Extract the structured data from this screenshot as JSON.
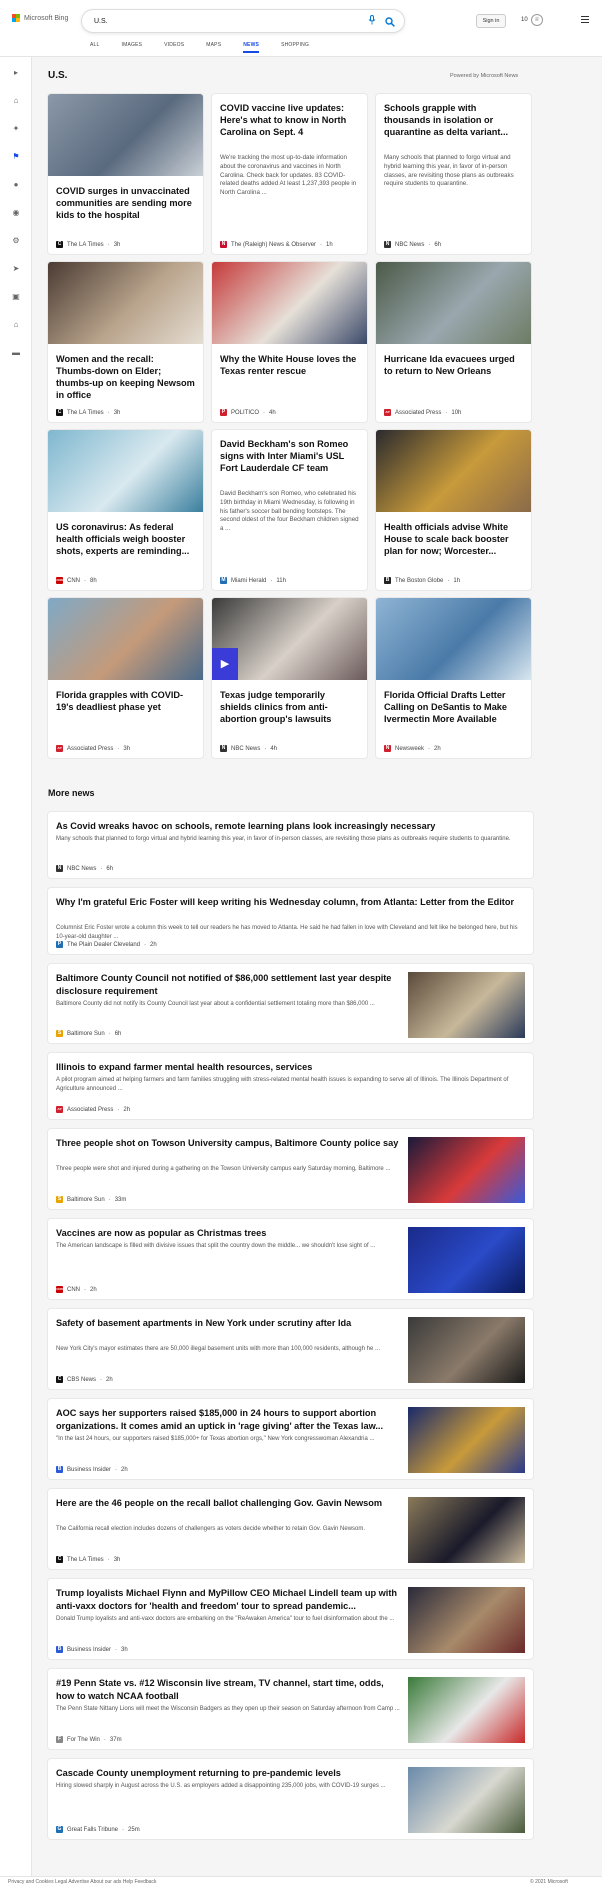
{
  "header": {
    "logo_text": "Microsoft Bing",
    "search_value": "U.S.",
    "signin_label": "Sign in",
    "reward_count": "10",
    "tabs": [
      "ALL",
      "IMAGES",
      "VIDEOS",
      "MAPS",
      "NEWS",
      "SHOPPING"
    ],
    "active_tab": "NEWS"
  },
  "rail": {
    "icons": [
      "expand-icon",
      "home-icon",
      "discover-icon",
      "flag-icon",
      "location-icon",
      "globe-icon",
      "tech-icon",
      "science-icon",
      "entertainment-icon",
      "politics-icon",
      "money-icon"
    ]
  },
  "page": {
    "title": "U.S.",
    "powered_by": "Powered by Microsoft News"
  },
  "top_stories": [
    {
      "title": "COVID surges in unvaccinated communities are sending more kids to the hospital",
      "snippet": "",
      "source": "The LA Times",
      "time": "3h",
      "src_icon": "C",
      "src_color": "#111111",
      "has_image": true,
      "img_colors": [
        "#8b98a8",
        "#5a6a7e",
        "#c9cfd6"
      ]
    },
    {
      "title": "COVID vaccine live updates: Here's what to know in North Carolina on Sept. 4",
      "snippet": "We're tracking the most up-to-date information about the coronavirus and vaccines in North Carolina. Check back for updates. 83 COVID-related deaths added At least 1,237,393 people in North Carolina ...",
      "source": "The (Raleigh) News & Observer",
      "time": "1h",
      "src_icon": "N",
      "src_color": "#c8102e",
      "has_image": false
    },
    {
      "title": "Schools grapple with thousands in isolation or quarantine as delta variant...",
      "snippet": "Many schools that planned to forgo virtual and hybrid learning this year, in favor of in-person classes, are revisiting those plans as outbreaks require students to quarantine.",
      "source": "NBC News",
      "time": "6h",
      "src_icon": "N",
      "src_color": "#333333",
      "has_image": false
    },
    {
      "title": "Women and the recall: Thumbs-down on Elder; thumbs-up on keeping Newsom in office",
      "snippet": "",
      "source": "The LA Times",
      "time": "3h",
      "src_icon": "C",
      "src_color": "#111111",
      "has_image": true,
      "img_colors": [
        "#4a3b33",
        "#b9a48c",
        "#e5ddd2"
      ]
    },
    {
      "title": "Why the White House loves the Texas renter rescue",
      "snippet": "",
      "source": "POLITICO",
      "time": "4h",
      "src_icon": "P",
      "src_color": "#d0202e",
      "has_image": true,
      "img_colors": [
        "#c53a3a",
        "#e6e0d8",
        "#3c4a6a"
      ]
    },
    {
      "title": "Hurricane Ida evacuees urged to return to New Orleans",
      "snippet": "",
      "source": "Associated Press",
      "time": "10h",
      "src_icon": "AP",
      "src_color": "#d0202e",
      "has_image": true,
      "img_colors": [
        "#4b5a48",
        "#9aa7ae",
        "#6d7c64"
      ]
    },
    {
      "title": "US coronavirus: As federal health officials weigh booster shots, experts are reminding...",
      "snippet": "",
      "source": "CNN",
      "time": "8h",
      "src_icon": "CNN",
      "src_color": "#cc0000",
      "has_image": true,
      "img_colors": [
        "#7fb7cf",
        "#d9e9ef",
        "#3b7f9e"
      ]
    },
    {
      "title": "David Beckham's son Romeo signs with Inter Miami's USL Fort Lauderdale CF team",
      "snippet": "David Beckham's son Romeo, who celebrated his 19th birthday in Miami Wednesday, is following in his father's soccer ball bending footsteps. The second oldest of the four Beckham children signed a ...",
      "source": "Miami Herald",
      "time": "11h",
      "src_icon": "M",
      "src_color": "#1f6fb2",
      "has_image": false
    },
    {
      "title": "Health officials advise White House to scale back booster plan for now; Worcester...",
      "snippet": "",
      "source": "The Boston Globe",
      "time": "1h",
      "src_icon": "B",
      "src_color": "#222222",
      "has_image": true,
      "img_colors": [
        "#2a2a2e",
        "#c89a3a",
        "#8a6a4a"
      ]
    },
    {
      "title": "Florida grapples with COVID-19's deadliest phase yet",
      "snippet": "",
      "source": "Associated Press",
      "time": "3h",
      "src_icon": "AP",
      "src_color": "#d0202e",
      "has_image": true,
      "img_colors": [
        "#7fa9c6",
        "#c49a7a",
        "#4a6a8a"
      ]
    },
    {
      "title": "Texas judge temporarily shields clinics from anti-abortion group's lawsuits",
      "snippet": "",
      "source": "NBC News",
      "time": "4h",
      "src_icon": "N",
      "src_color": "#333333",
      "has_image": true,
      "video": true,
      "img_colors": [
        "#3a3a3a",
        "#d8d0c8",
        "#6a5a5a"
      ]
    },
    {
      "title": "Florida Official Drafts Letter Calling on DeSantis to Make Ivermectin More Available",
      "snippet": "",
      "source": "Newsweek",
      "time": "2h",
      "src_icon": "N",
      "src_color": "#d0202e",
      "has_image": true,
      "img_colors": [
        "#8fb4d4",
        "#4a7aa8",
        "#d8e6f0"
      ]
    }
  ],
  "more_news": {
    "heading": "More news",
    "items": [
      {
        "title": "As Covid wreaks havoc on schools, remote learning plans look increasingly necessary",
        "snippet": "Many schools that planned to forgo virtual and hybrid learning this year, in favor of in-person classes, are revisiting those plans as outbreaks require students to quarantine.",
        "source": "NBC News",
        "time": "6h",
        "src_icon": "N",
        "src_color": "#333333",
        "has_image": false
      },
      {
        "title": "Why I'm grateful Eric Foster will keep writing his Wednesday column, from Atlanta: Letter from the Editor",
        "snippet": "Columnist Eric Foster wrote a column this week to tell our readers he has moved to Atlanta. He said he had fallen in love with Cleveland and felt like he belonged here, but his 10-year-old daughter ...",
        "source": "The Plain Dealer Cleveland",
        "time": "2h",
        "src_icon": "P",
        "src_color": "#1f6fb2",
        "has_image": false
      },
      {
        "title": "Baltimore County Council not notified of $86,000 settlement last year despite disclosure requirement",
        "snippet": "Baltimore County did not notify its County Council last year about a confidential settlement totaling more than $86,000 ...",
        "source": "Baltimore Sun",
        "time": "6h",
        "src_icon": "S",
        "src_color": "#e8a400",
        "has_image": true,
        "img_colors": [
          "#5a4a3a",
          "#c8b89a",
          "#2a3a5a"
        ]
      },
      {
        "title": "Illinois to expand farmer mental health resources, services",
        "snippet": "A pilot program aimed at helping farmers and farm families struggling with stress-related mental health issues is expanding to serve all of Illinois. The Illinois Department of Agriculture announced ...",
        "source": "Associated Press",
        "time": "2h",
        "src_icon": "AP",
        "src_color": "#d0202e",
        "has_image": false
      },
      {
        "title": "Three people shot on Towson University campus, Baltimore County police say",
        "snippet": "Three people were shot and injured during a gathering on the Towson University campus early Saturday morning, Baltimore ...",
        "source": "Baltimore Sun",
        "time": "33m",
        "src_icon": "S",
        "src_color": "#e8a400",
        "has_image": true,
        "img_colors": [
          "#1a1a3a",
          "#d83a3a",
          "#3a5ad8"
        ]
      },
      {
        "title": "Vaccines are now as popular as Christmas trees",
        "snippet": "The American landscape is filled with divisive issues that split the country down the middle... we shouldn't lose sight of ...",
        "source": "CNN",
        "time": "2h",
        "src_icon": "CNN",
        "src_color": "#cc0000",
        "has_image": true,
        "img_colors": [
          "#1a2a8a",
          "#2a4ac8",
          "#0a1a5a"
        ]
      },
      {
        "title": "Safety of basement apartments in New York under scrutiny after Ida",
        "snippet": "New York City's mayor estimates there are 50,000 illegal basement units with more than 100,000 residents, although he ...",
        "source": "CBS News",
        "time": "2h",
        "src_icon": "C",
        "src_color": "#111111",
        "has_image": true,
        "img_colors": [
          "#3a3a3a",
          "#8a7a6a",
          "#1a1a1a"
        ]
      },
      {
        "title": "AOC says her supporters raised $185,000 in 24 hours to support abortion organizations. It comes amid an uptick in 'rage giving' after the Texas law...",
        "snippet": "\"In the last 24 hours, our supporters raised $185,000+ for Texas abortion orgs,\" New York congresswoman Alexandria ...",
        "source": "Business Insider",
        "time": "2h",
        "src_icon": "B",
        "src_color": "#2a5ad8",
        "has_image": true,
        "img_colors": [
          "#1a2a6a",
          "#c89a3a",
          "#2a3a8a"
        ]
      },
      {
        "title": "Here are the 46 people on the recall ballot challenging Gov. Gavin Newsom",
        "snippet": "The California recall election includes dozens of challengers as voters decide whether to retain Gov. Gavin Newsom.",
        "source": "The LA Times",
        "time": "3h",
        "src_icon": "C",
        "src_color": "#111111",
        "has_image": true,
        "img_colors": [
          "#8a7a5a",
          "#1a1a2a",
          "#c8b89a"
        ]
      },
      {
        "title": "Trump loyalists Michael Flynn and MyPillow CEO Michael Lindell team up with anti-vaxx doctors for 'health and freedom' tour to spread pandemic...",
        "snippet": "Donald Trump loyalists and anti-vaxx doctors are embarking on the \"ReAwaken America\" tour to fuel disinformation about the ...",
        "source": "Business Insider",
        "time": "3h",
        "src_icon": "B",
        "src_color": "#2a5ad8",
        "has_image": true,
        "img_colors": [
          "#2a2a3a",
          "#a88a6a",
          "#6a2a2a"
        ]
      },
      {
        "title": "#19 Penn State vs. #12 Wisconsin live stream, TV channel, start time, odds, how to watch NCAA football",
        "snippet": "The Penn State Nittany Lions will meet the Wisconsin Badgers as they open up their season on Saturday afternoon from Camp ...",
        "source": "For The Win",
        "time": "37m",
        "src_icon": "F",
        "src_color": "#888888",
        "has_image": true,
        "img_colors": [
          "#3a7a3a",
          "#e8e8e8",
          "#c82a2a"
        ]
      },
      {
        "title": "Cascade County unemployment returning to pre-pandemic levels",
        "snippet": "Hiring slowed sharply in August across the U.S. as employers added a disappointing 235,000 jobs, with COVID-19 surges ...",
        "source": "Great Falls Tribune",
        "time": "25m",
        "src_icon": "G",
        "src_color": "#1f6fb2",
        "has_image": true,
        "img_colors": [
          "#6a8aaa",
          "#d8d8d0",
          "#4a5a3a"
        ]
      }
    ]
  },
  "footer": {
    "left_text": "Privacy and Cookies   Legal   Advertise   About our ads   Help   Feedback",
    "copyright": "© 2021 Microsoft"
  }
}
